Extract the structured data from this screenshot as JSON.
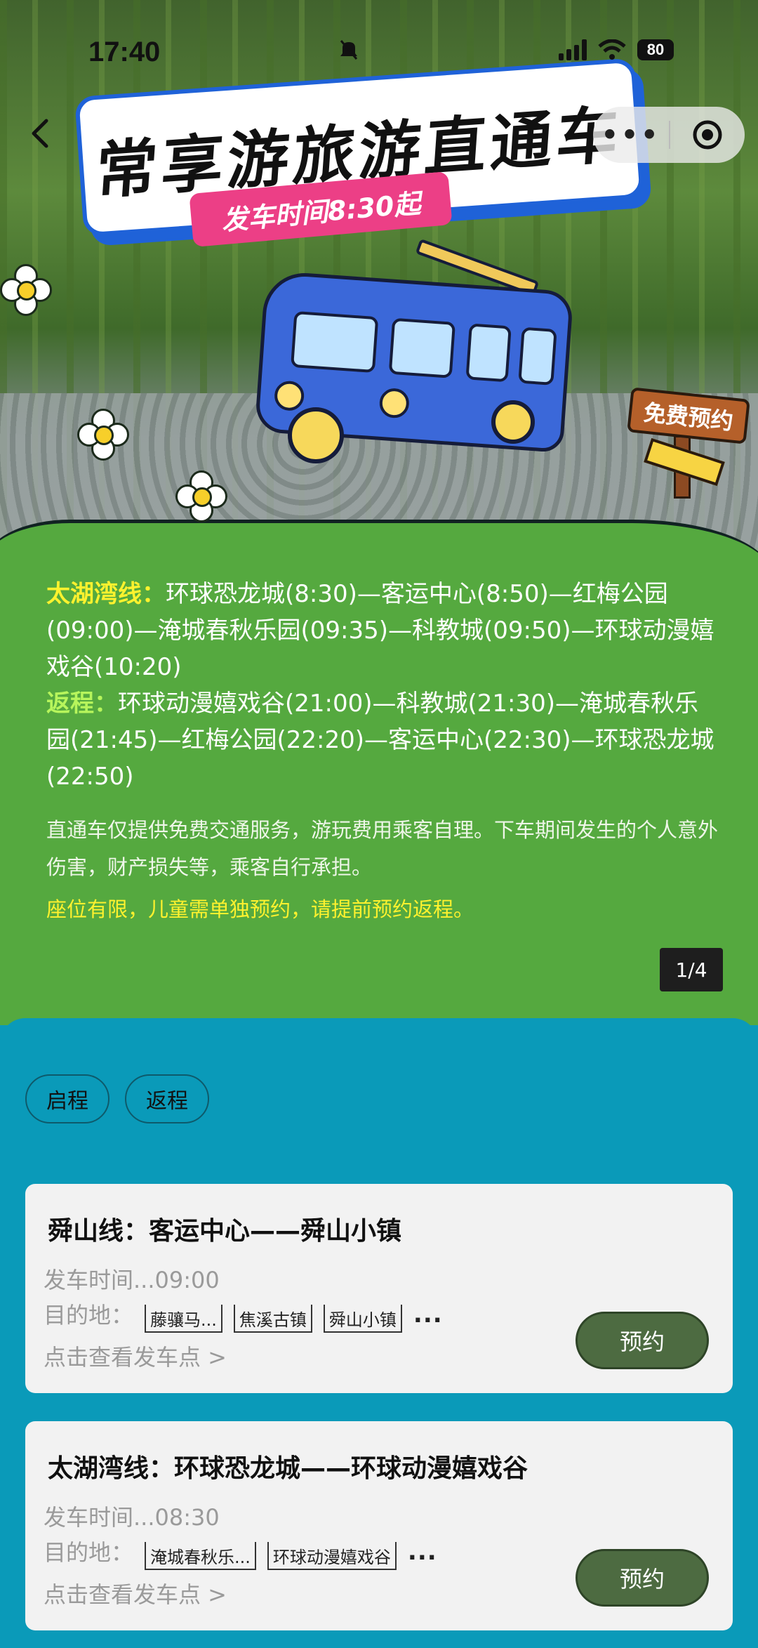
{
  "status_bar": {
    "time": "17:40",
    "battery": "80"
  },
  "nav": {
    "more_label": "•••"
  },
  "hero": {
    "title": "常享游旅游直通车",
    "time_tag": "发车时间8:30起",
    "sign_label": "免费预约"
  },
  "route_info": {
    "outbound_label": "太湖湾线：",
    "outbound_text": "环球恐龙城(8:30)—客运中心(8:50)—红梅公园(09:00)—淹城春秋乐园(09:35)—科教城(09:50)—环球动漫嬉戏谷(10:20)",
    "return_label": "返程：",
    "return_text": "环球动漫嬉戏谷(21:00)—科教城(21:30)—淹城春秋乐园(21:45)—红梅公园(22:20)—客运中心(22:30)—环球恐龙城(22:50)",
    "note": "直通车仅提供免费交通服务，游玩费用乘客自理。下车期间发生的个人意外伤害，财产损失等，乘客自行承担。",
    "warning": "座位有限，儿童需单独预约，请提前预约返程。",
    "pager": "1/4"
  },
  "tabs": [
    {
      "label": "启程"
    },
    {
      "label": "返程"
    }
  ],
  "routes": [
    {
      "title": "舜山线：客运中心——舜山小镇",
      "departure": "发车时间...09:00",
      "dest_label": "目的地：",
      "destinations": [
        "藤骧马...",
        "焦溪古镇",
        "舜山小镇"
      ],
      "more": "...",
      "link": "点击查看发车点 >",
      "button": "预约"
    },
    {
      "title": "太湖湾线：环球恐龙城——环球动漫嬉戏谷",
      "departure": "发车时间...08:30",
      "dest_label": "目的地：",
      "destinations": [
        "淹城春秋乐...",
        "环球动漫嬉戏谷"
      ],
      "more": "...",
      "link": "点击查看发车点 >",
      "button": "预约"
    }
  ],
  "colors": {
    "hero_green": "#55a93f",
    "panel_teal": "#0a9ab9",
    "highlight_yellow": "#fff22e",
    "button_green": "#4d6b41",
    "title_blue": "#1f62d8",
    "tag_pink": "#ec3f86"
  },
  "icons": [
    "back-arrow-icon",
    "more-dots-icon",
    "close-target-icon",
    "signal-icon",
    "wifi-icon",
    "battery-icon",
    "mute-icon"
  ]
}
